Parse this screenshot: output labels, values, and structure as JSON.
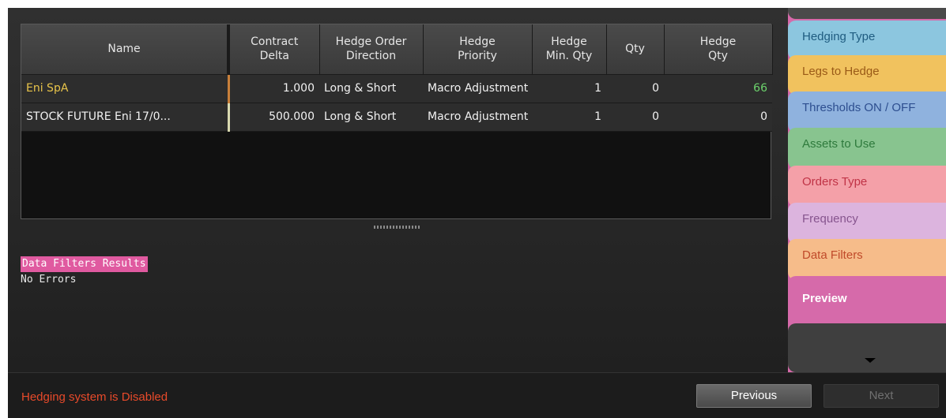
{
  "grid": {
    "headers": [
      "Name",
      "Contract\nDelta",
      "Hedge Order\nDirection",
      "Hedge\nPriority",
      "Hedge\nMin. Qty",
      "Qty",
      "Hedge\nQty"
    ],
    "rows": [
      [
        "Eni SpA",
        "1.000",
        "Long & Short",
        "Macro Adjustment",
        "1",
        "0",
        "66"
      ],
      [
        "STOCK FUTURE Eni 17/0...",
        "500.000",
        "Long & Short",
        "Macro Adjustment",
        "1",
        "0",
        "0"
      ]
    ]
  },
  "log": {
    "title": "Data Filters Results",
    "message": "No Errors"
  },
  "side_tabs": [
    "Hedging Type",
    "Legs to Hedge",
    "Thresholds ON / OFF",
    "Assets to Use",
    "Orders Type",
    "Frequency",
    "Data Filters",
    "Preview"
  ],
  "footer": {
    "status": "Hedging system is Disabled",
    "previous_label": "Previous",
    "next_label": "Next"
  },
  "icons": {
    "scroll_down": "chevron-down-icon",
    "splitter": "grip-handle-icon"
  },
  "colors": {
    "status_text": "#e84a2a",
    "active_tab": "#d66aaa",
    "log_highlight": "#e05aa0",
    "positive_qty": "#6cd36c",
    "name_highlight": "#e8c44a"
  }
}
